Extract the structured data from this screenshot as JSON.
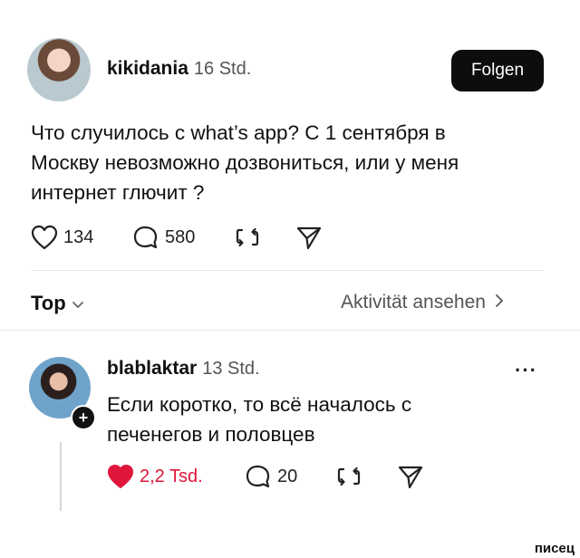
{
  "post": {
    "username": "kikidania",
    "time": "16 Std.",
    "follow_label": "Folgen",
    "text_lines": [
      "Что случилось с what’s app? С 1 сентября в",
      "Москву  невозможно дозвониться, или у меня",
      "интернет глючит ?"
    ],
    "likes": "134",
    "comments": "580"
  },
  "filters": {
    "sort_label": "Top",
    "activity_label": "Aktivität ansehen"
  },
  "reply": {
    "username": "blablaktar",
    "time": "13 Std.",
    "text_lines": [
      "Если коротко, то всё началось с",
      "печенегов и половцев"
    ],
    "likes": "2,2 Tsd.",
    "comments": "20",
    "more_label": "···"
  },
  "watermark": "писец",
  "colors": {
    "like_active": "#e0163d",
    "follow_bg": "#0d0d0d",
    "divider": "#e6e6e6"
  }
}
